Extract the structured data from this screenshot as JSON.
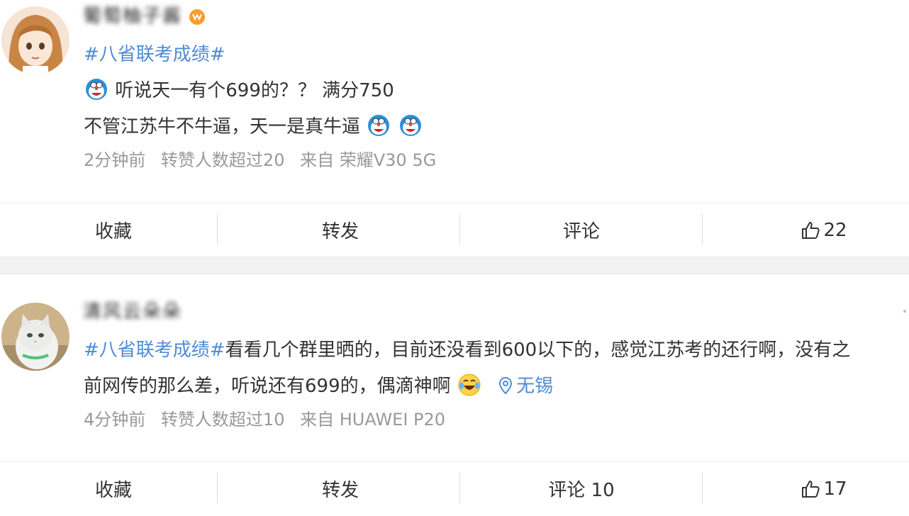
{
  "posts": [
    {
      "username": "葡萄柚子酱",
      "hashtag": "#八省联考成绩#",
      "line1": "听说天一有个699的？？ 满分750",
      "line2": "不管江苏牛不牛逼，天一是真牛逼",
      "meta": {
        "time": "2分钟前",
        "reposts": "转赞人数超过20",
        "source": "来自 荣耀V30 5G"
      },
      "actions": {
        "favorite": "收藏",
        "repost": "转发",
        "comment": "评论",
        "like_count": "22"
      },
      "icons": [
        "vip-badge",
        "doraemon-emoji"
      ]
    },
    {
      "username": "清风云朵朵",
      "hashtag": "#八省联考成绩#",
      "line1_text": "看看几个群里晒的，目前还没看到600以下的，感觉江苏考的还行啊，没有之",
      "line2_text": "前网传的那么差，听说还有699的，偶滴神啊",
      "location": "无锡",
      "meta": {
        "time": "4分钟前",
        "reposts": "转赞人数超过10",
        "source": "来自 HUAWEI P20"
      },
      "actions": {
        "favorite": "收藏",
        "repost": "转发",
        "comment": "评论 10",
        "like_count": "17"
      },
      "icons": [
        "laugh-cry-emoji",
        "location-pin-icon"
      ]
    }
  ],
  "colors": {
    "link": "#4f8bd6",
    "meta": "#999999",
    "text": "#333333",
    "separator_band": "#f2f2f2"
  }
}
